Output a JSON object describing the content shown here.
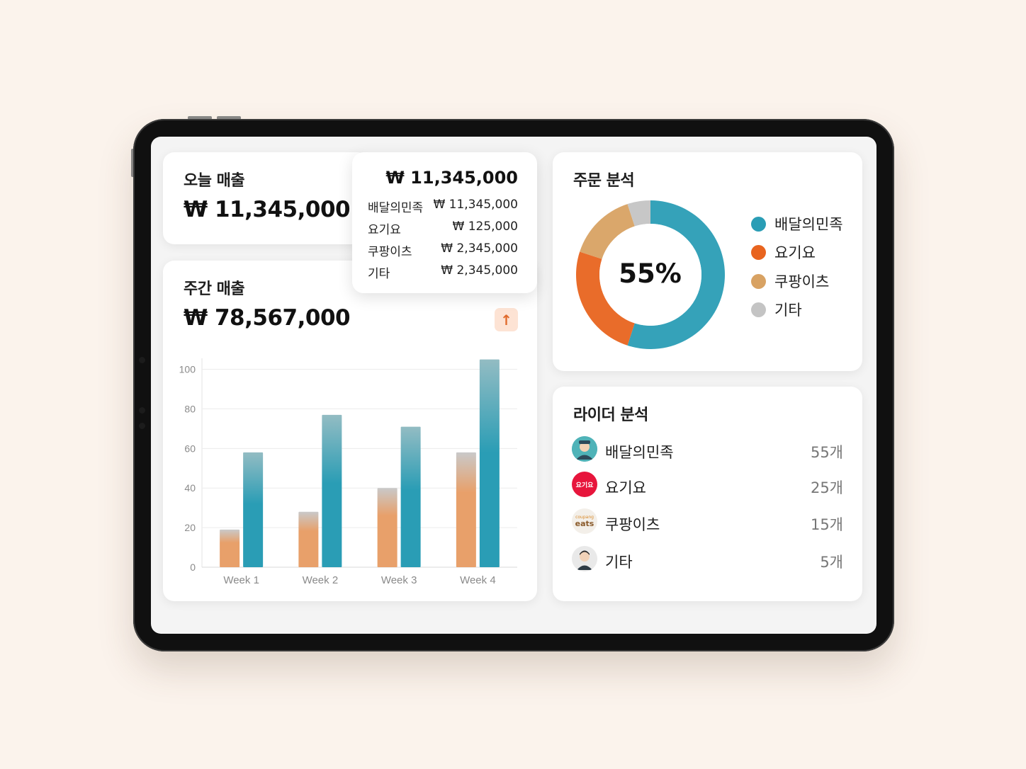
{
  "today_sales": {
    "title": "오늘 매출",
    "amount": "₩ 11,345,000"
  },
  "breakdown_popup": {
    "total": "₩ 11,345,000",
    "rows": [
      {
        "label": "배달의민족",
        "value": "₩ 11,345,000"
      },
      {
        "label": "요기요",
        "value": "₩ 125,000"
      },
      {
        "label": "쿠팡이츠",
        "value": "₩ 2,345,000"
      },
      {
        "label": "기타",
        "value": "₩ 2,345,000"
      }
    ]
  },
  "weekly_sales": {
    "title": "주간 매출",
    "amount": "₩ 78,567,000",
    "trend_icon": "arrow-up-icon"
  },
  "order_analysis": {
    "title": "주문 분석",
    "center_label": "55%",
    "legend": [
      {
        "label": "배달의민족",
        "color": "#2a9db5"
      },
      {
        "label": "요기요",
        "color": "#e8641f"
      },
      {
        "label": "쿠팡이츠",
        "color": "#d8a263"
      },
      {
        "label": "기타",
        "color": "#c4c4c4"
      }
    ]
  },
  "rider_analysis": {
    "title": "라이더 분석",
    "rows": [
      {
        "name": "배달의민족",
        "count": "55개",
        "avatar": "baemin-avatar"
      },
      {
        "name": "요기요",
        "count": "25개",
        "avatar": "yogiyo-logo",
        "logo_text": "요기요"
      },
      {
        "name": "쿠팡이츠",
        "count": "15개",
        "avatar": "coupang-eats-logo",
        "logo_text_top": "coupang",
        "logo_text_bottom": "eats"
      },
      {
        "name": "기타",
        "count": "5개",
        "avatar": "person-avatar"
      }
    ]
  },
  "chart_data": [
    {
      "type": "bar",
      "categories": [
        "Week 1",
        "Week 2",
        "Week 3",
        "Week 4"
      ],
      "series": [
        {
          "values": [
            19,
            28,
            40,
            58
          ],
          "color": "#e8a06a"
        },
        {
          "values": [
            58,
            77,
            71,
            105
          ],
          "color": "#2a9db5"
        }
      ],
      "yticks": [
        0,
        20,
        40,
        60,
        80,
        100
      ],
      "ylim": [
        0,
        112
      ],
      "grid": true
    },
    {
      "type": "pie",
      "labels": [
        "배달의민족",
        "요기요",
        "쿠팡이츠",
        "기타"
      ],
      "values": [
        55,
        25,
        15,
        5
      ],
      "colors": [
        "#2a9db5",
        "#e8641f",
        "#d8a263",
        "#c4c4c4"
      ]
    }
  ]
}
